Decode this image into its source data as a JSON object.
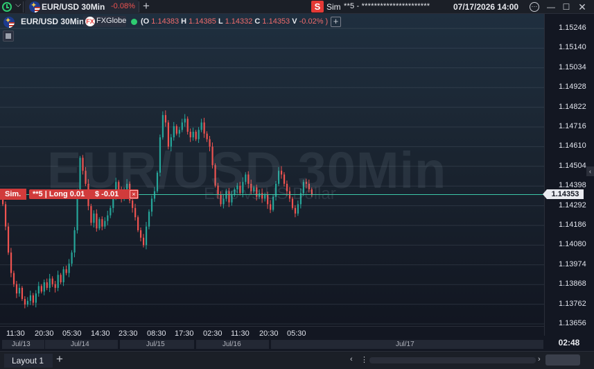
{
  "topbar": {
    "instrument": "EUR/USD 30Min",
    "change": "-0.08%",
    "sim_badge": "S",
    "sim_label": "Sim",
    "account": "**5 - **********************",
    "datetime": "07/17/2026 14:00"
  },
  "legend": {
    "instrument": "EUR/USD 30Min",
    "source": "FXGlobe",
    "source_icon": "FX",
    "o_label": "(O",
    "o": "1.14383",
    "h_label": "H",
    "h": "1.14385",
    "l_label": "L",
    "l": "1.14332",
    "c_label": "C",
    "c": "1.14353",
    "v_label": "V",
    "v": "-0.02% )"
  },
  "watermark": {
    "title": "EUR/USD 30Min",
    "subtitle": "Euro vs US Dollar"
  },
  "position": {
    "tag": "Sim.",
    "account_side": "**5 | Long 0.01",
    "pnl": "$ -0.01",
    "close": "×"
  },
  "current_price": "1.14353",
  "clock": "02:48",
  "bottombar": {
    "layout_tab": "Layout 1"
  },
  "colors": {
    "up": "#26a69a",
    "down": "#ef5350",
    "accent_red": "#d13b3b",
    "live": "#2ecc71"
  },
  "chart_data": {
    "type": "candlestick",
    "price_ticks": [
      "1.15246",
      "1.15140",
      "1.15034",
      "1.14928",
      "1.14822",
      "1.14716",
      "1.14610",
      "1.14504",
      "1.14398",
      "1.14292",
      "1.14186",
      "1.14080",
      "1.13974",
      "1.13868",
      "1.13762",
      "1.13656"
    ],
    "ylim": [
      1.13656,
      1.15246
    ],
    "time_ticks": [
      "11:30",
      "20:30",
      "05:30",
      "14:30",
      "23:30",
      "08:30",
      "17:30",
      "02:30",
      "11:30",
      "20:30",
      "05:30"
    ],
    "dates": [
      "Jul/13",
      "Jul/14",
      "Jul/15",
      "Jul/16",
      "Jul/17"
    ],
    "position_price": 1.14345,
    "closes": [
      1.143,
      1.1418,
      1.1404,
      1.1393,
      1.1387,
      1.1382,
      1.1385,
      1.1379,
      1.1376,
      1.1378,
      1.1381,
      1.1377,
      1.1382,
      1.1386,
      1.1383,
      1.1388,
      1.1385,
      1.139,
      1.1387,
      1.1385,
      1.1392,
      1.1388,
      1.1395,
      1.1393,
      1.1398,
      1.1404,
      1.1416,
      1.1436,
      1.1455,
      1.1448,
      1.1441,
      1.1429,
      1.142,
      1.1425,
      1.1417,
      1.1422,
      1.1418,
      1.1421,
      1.1424,
      1.1428,
      1.1434,
      1.1442,
      1.1438,
      1.1433,
      1.1437,
      1.1441,
      1.1432,
      1.1428,
      1.1423,
      1.1416,
      1.1412,
      1.1408,
      1.1418,
      1.1426,
      1.1433,
      1.1437,
      1.1447,
      1.1466,
      1.1478,
      1.1474,
      1.1461,
      1.1466,
      1.1472,
      1.1468,
      1.147,
      1.1474,
      1.1476,
      1.1469,
      1.1466,
      1.1469,
      1.1465,
      1.147,
      1.1474,
      1.1468,
      1.1465,
      1.1461,
      1.1451,
      1.144,
      1.1435,
      1.143,
      1.1433,
      1.1437,
      1.1431,
      1.1435,
      1.1438,
      1.144,
      1.1436,
      1.1442,
      1.1446,
      1.1441,
      1.1437,
      1.1439,
      1.1434,
      1.1436,
      1.1433,
      1.1435,
      1.143,
      1.1427,
      1.1434,
      1.1441,
      1.1448,
      1.1446,
      1.1441,
      1.1437,
      1.1433,
      1.1428,
      1.1425,
      1.143,
      1.1436,
      1.1442,
      1.1441,
      1.1438,
      1.1435
    ]
  }
}
